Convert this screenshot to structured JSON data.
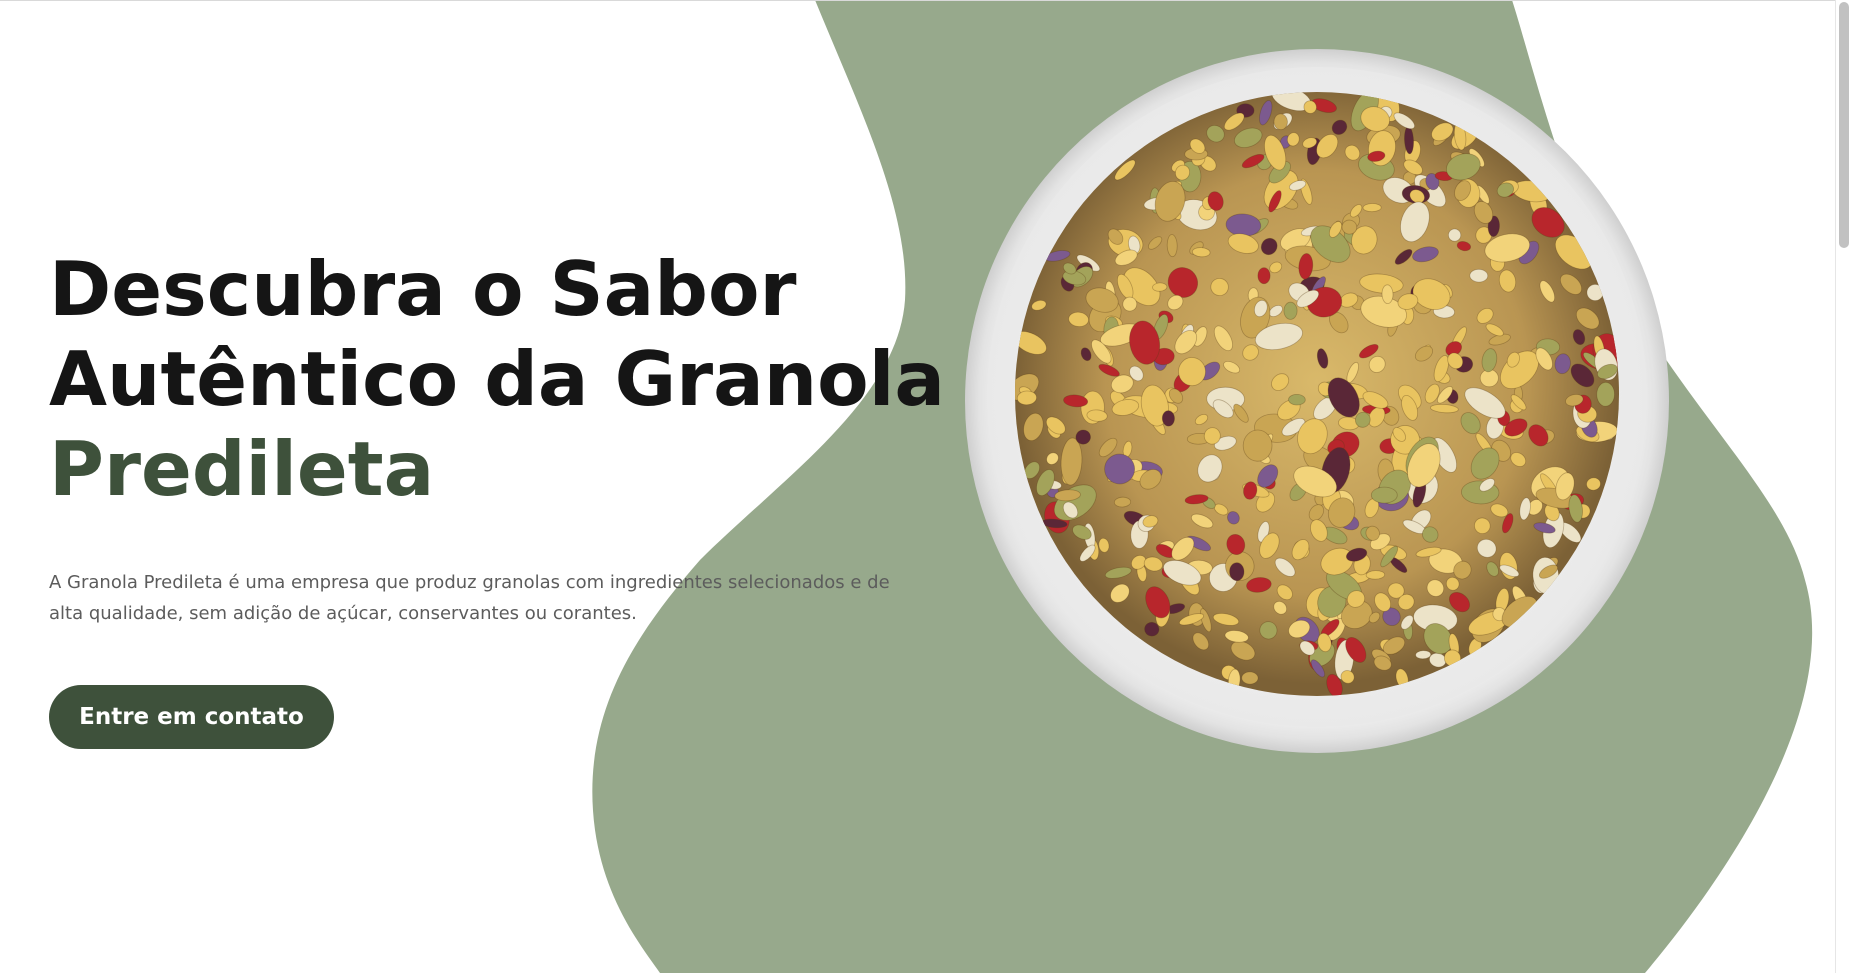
{
  "hero": {
    "headline_line1": "Descubra o Sabor",
    "headline_line2": "Autêntico da Granola",
    "headline_accent": "Predileta",
    "description": "A Granola Predileta é uma empresa que produz granolas com ingredientes selecionados e de alta qualidade, sem adição de açúcar, conservantes ou corantes.",
    "cta_label": "Entre em contato",
    "image_alt": "Tigela de granola",
    "image_icon": "granola-bowl-image"
  },
  "colors": {
    "background": "#ffffff",
    "blob": "#97a98c",
    "headline": "#151515",
    "accent": "#3e513b",
    "button": "#3e513b",
    "button_text": "#ffffff",
    "body_text": "#5c5c5c"
  }
}
